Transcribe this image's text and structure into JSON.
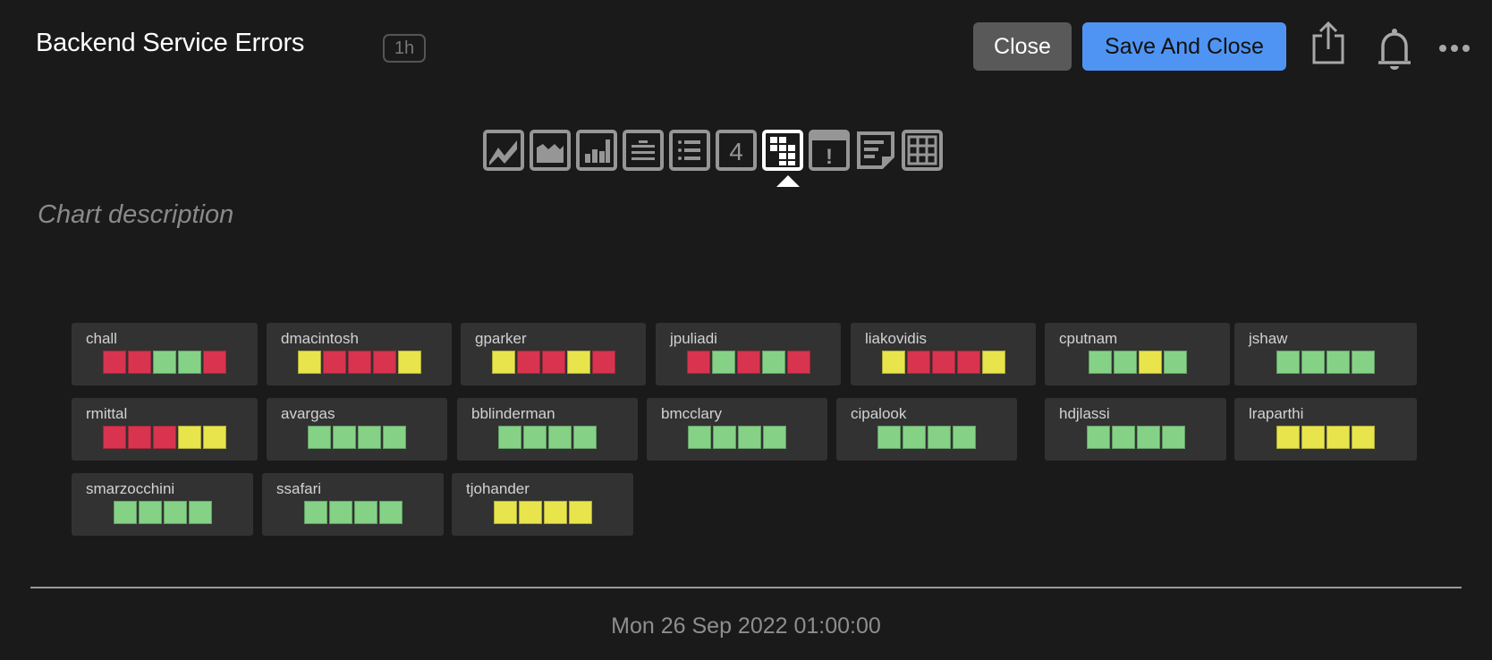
{
  "header": {
    "title": "Backend Service Errors",
    "time_range": "1h",
    "close_label": "Close",
    "save_label": "Save And Close",
    "icons": [
      "share-icon",
      "bell-icon",
      "more-icon"
    ]
  },
  "toolbar": {
    "chart_types": [
      {
        "name": "line-chart",
        "selected": false
      },
      {
        "name": "area-chart",
        "selected": false
      },
      {
        "name": "column-chart",
        "selected": false
      },
      {
        "name": "heatmap-chart",
        "selected": false
      },
      {
        "name": "list-chart",
        "selected": false
      },
      {
        "name": "single-value",
        "label": "4",
        "selected": false
      },
      {
        "name": "honeycomb-chart",
        "selected": true
      },
      {
        "name": "alert-chart",
        "label": "!",
        "selected": false
      },
      {
        "name": "text-note",
        "selected": false
      },
      {
        "name": "table-chart",
        "selected": false
      }
    ]
  },
  "description_placeholder": "Chart description",
  "colors": {
    "red": "#d9344f",
    "green": "#85d287",
    "yellow": "#e8e44c"
  },
  "cards": [
    {
      "name": "chall",
      "cells": [
        "red",
        "red",
        "green",
        "green",
        "red"
      ]
    },
    {
      "name": "dmacintosh",
      "cells": [
        "yellow",
        "red",
        "red",
        "red",
        "yellow"
      ]
    },
    {
      "name": "gparker",
      "cells": [
        "yellow",
        "red",
        "red",
        "yellow",
        "red"
      ]
    },
    {
      "name": "jpuliadi",
      "cells": [
        "red",
        "green",
        "red",
        "green",
        "red"
      ]
    },
    {
      "name": "liakovidis",
      "cells": [
        "yellow",
        "red",
        "red",
        "red",
        "yellow"
      ]
    },
    {
      "name": "cputnam",
      "cells": [
        "green",
        "green",
        "yellow",
        "green"
      ]
    },
    {
      "name": "jshaw",
      "cells": [
        "green",
        "green",
        "green",
        "green"
      ]
    },
    {
      "name": "rmittal",
      "cells": [
        "red",
        "red",
        "red",
        "yellow",
        "yellow"
      ]
    },
    {
      "name": "avargas",
      "cells": [
        "green",
        "green",
        "green",
        "green"
      ]
    },
    {
      "name": "bblinderman",
      "cells": [
        "green",
        "green",
        "green",
        "green"
      ]
    },
    {
      "name": "bmcclary",
      "cells": [
        "green",
        "green",
        "green",
        "green"
      ]
    },
    {
      "name": "cipalook",
      "cells": [
        "green",
        "green",
        "green",
        "green"
      ]
    },
    {
      "name": "hdjlassi",
      "cells": [
        "green",
        "green",
        "green",
        "green"
      ]
    },
    {
      "name": "lraparthi",
      "cells": [
        "yellow",
        "yellow",
        "yellow",
        "yellow"
      ]
    },
    {
      "name": "smarzocchini",
      "cells": [
        "green",
        "green",
        "green",
        "green"
      ]
    },
    {
      "name": "ssafari",
      "cells": [
        "green",
        "green",
        "green",
        "green"
      ]
    },
    {
      "name": "tjohander",
      "cells": [
        "yellow",
        "yellow",
        "yellow",
        "yellow"
      ]
    }
  ],
  "footer": {
    "timestamp": "Mon 26 Sep 2022 01:00:00"
  }
}
